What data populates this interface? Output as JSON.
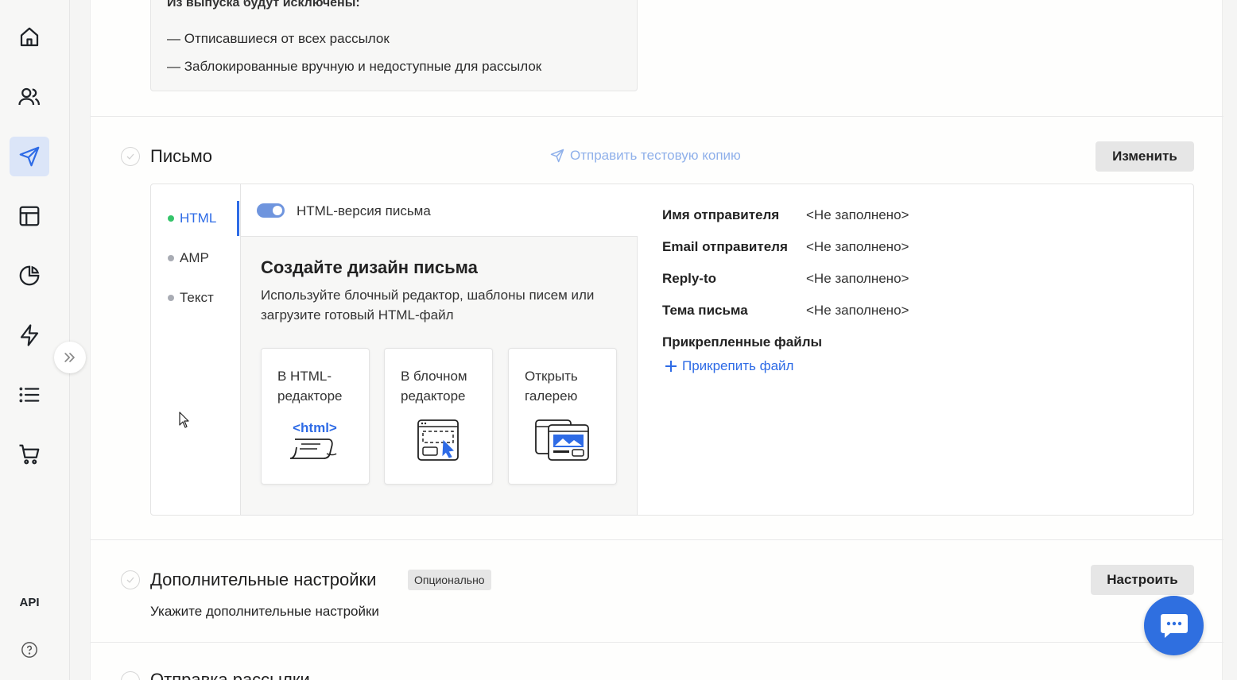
{
  "sidebar": {
    "items": [
      {
        "icon": "home-icon"
      },
      {
        "icon": "users-icon"
      },
      {
        "icon": "send-icon",
        "active": true
      },
      {
        "icon": "layout-icon"
      },
      {
        "icon": "pie-chart-icon"
      },
      {
        "icon": "lightning-icon"
      },
      {
        "icon": "list-icon"
      },
      {
        "icon": "cart-icon"
      }
    ],
    "api_label": "API",
    "help_icon": "help-icon",
    "expand_icon": "double-chevron-right-icon"
  },
  "exclusions": {
    "title": "Из выпуска будут исключены:",
    "items": [
      "— Отписавшиеся от всех рассылок",
      "— Заблокированные вручную и недоступные для рассылок"
    ]
  },
  "letter": {
    "title": "Письмо",
    "test_link": "Отправить тестовую копию",
    "edit_button": "Изменить",
    "tabs": [
      {
        "label": "HTML",
        "active": true
      },
      {
        "label": "AMP"
      },
      {
        "label": "Текст"
      }
    ],
    "toggle_label": "HTML-версия письма",
    "toggle_on": true,
    "design_title": "Создайте дизайн письма",
    "design_desc": "Используйте блочный редактор, шаблоны писем или загрузите готовый HTML-файл",
    "cards": [
      {
        "label": "В HTML-редакторе",
        "icon": "html-editor-icon",
        "icon_text": "<html>"
      },
      {
        "label": "В блочном редакторе",
        "icon": "block-editor-icon"
      },
      {
        "label": "Открыть галерею",
        "icon": "gallery-icon"
      }
    ],
    "info": [
      {
        "key": "Имя отправителя",
        "value": "<Не заполнено>"
      },
      {
        "key": "Email отправителя",
        "value": "<Не заполнено>"
      },
      {
        "key": "Reply-to",
        "value": "<Не заполнено>"
      },
      {
        "key": "Тема письма",
        "value": "<Не заполнено>"
      }
    ],
    "attachments_label": "Прикрепленные файлы",
    "attach_link": "Прикрепить файл"
  },
  "extra": {
    "title": "Дополнительные настройки",
    "badge": "Опционально",
    "button": "Настроить",
    "description": "Укажите дополнительные настройки"
  },
  "next_section": {
    "title": "Отправка рассылки"
  },
  "colors": {
    "accent": "#2e6be6",
    "active_nav_bg": "#dbe5f8",
    "html_dot": "#35c46a",
    "chat_button": "#2f6fe0"
  }
}
